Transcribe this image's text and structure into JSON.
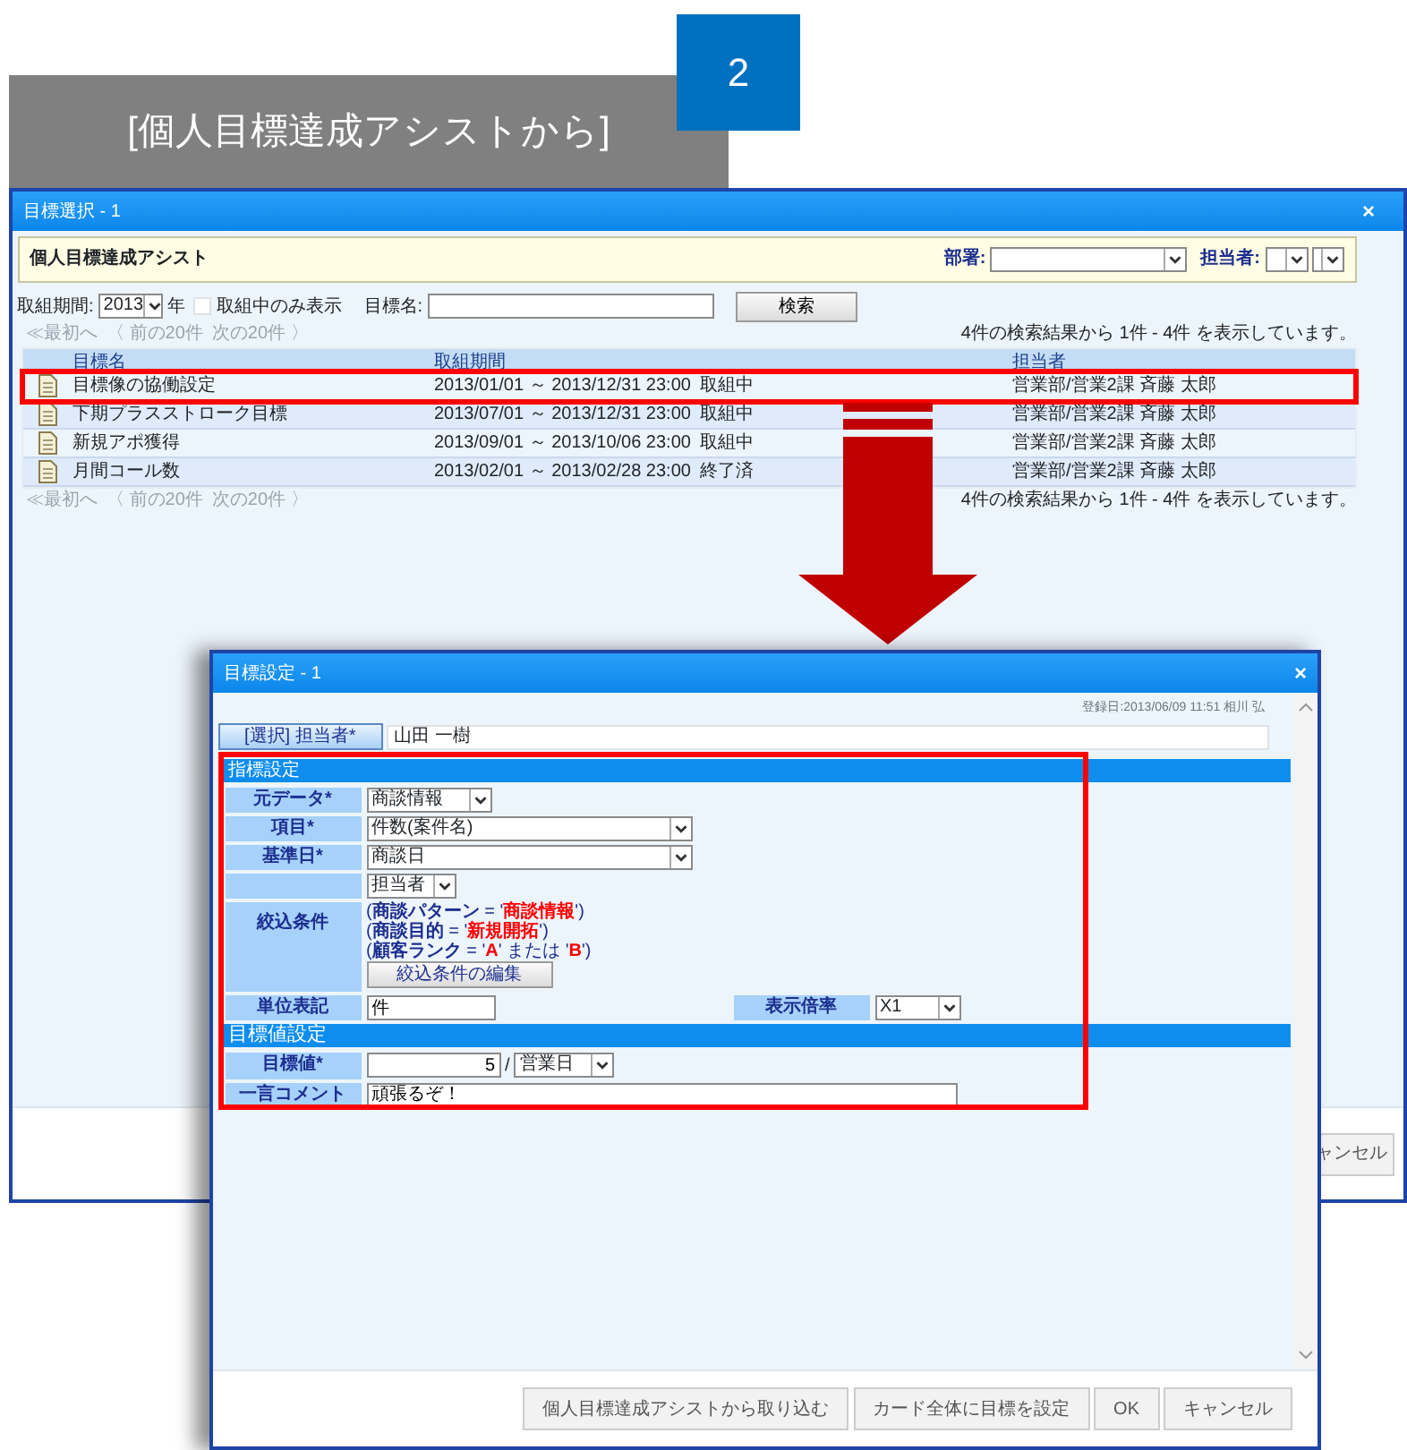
{
  "caption": {
    "text": "[個人目標達成アシストから]",
    "number": "2"
  },
  "window_back": {
    "title": "目標選択 - 1",
    "close": "×",
    "header": {
      "title": "個人目標達成アシスト",
      "dept_label": "部署:",
      "owner_label": "担当者:"
    },
    "filter": {
      "period_label": "取組期間:",
      "year": "2013",
      "year_unit": "年",
      "active_only": {
        "label": "取組中のみ表示",
        "checked": false
      },
      "name_label": "目標名:",
      "search_button": "検索"
    },
    "pager_top": {
      "first": "≪最初へ",
      "prev": "〈 前の20件",
      "next": "次の20件 〉",
      "summary": "4件の検索結果から 1件 - 4件 を表示しています。"
    },
    "columns": [
      "目標名",
      "取組期間",
      "担当者"
    ],
    "rows": [
      {
        "name": "目標像の協働設定",
        "period": "2013/01/01 ～ 2013/12/31 23:00",
        "status": "取組中",
        "owner": "営業部/営業2課 斉藤 太郎",
        "highlighted": true
      },
      {
        "name": "下期プラスストローク目標",
        "period": "2013/07/01 ～ 2013/12/31 23:00",
        "status": "取組中",
        "owner": "営業部/営業2課 斉藤 太郎",
        "highlighted": false
      },
      {
        "name": "新規アポ獲得",
        "period": "2013/09/01 ～ 2013/10/06 23:00",
        "status": "取組中",
        "owner": "営業部/営業2課 斉藤 太郎",
        "highlighted": false
      },
      {
        "name": "月間コール数",
        "period": "2013/02/01 ～ 2013/02/28 23:00",
        "status": "終了済",
        "owner": "営業部/営業2課 斉藤 太郎",
        "highlighted": false
      }
    ],
    "pager_bottom": {
      "first": "≪最初へ",
      "prev": "〈 前の20件",
      "next": "次の20件 〉",
      "summary": "4件の検索結果から 1件 - 4件 を表示しています。"
    },
    "footer_button": "ャンセル"
  },
  "window_front": {
    "title": "目標設定 - 1",
    "close": "×",
    "registered": "登録日:2013/06/09 11:51 相川 弘",
    "assignee_button": "[選択] 担当者*",
    "assignee": "山田 一樹",
    "highlighted": true,
    "section_indicator": "指標設定",
    "source_label": "元データ*",
    "source": "商談情報",
    "item_label": "項目*",
    "item": "件数(案件名)",
    "base_date_label": "基準日*",
    "base_date": "商談日",
    "owner_select": "担当者",
    "filter_label": "絞込条件",
    "conditions": [
      [
        {
          "kind": "plain",
          "text": "("
        },
        {
          "kind": "field",
          "text": "商談パターン"
        },
        {
          "kind": "plain",
          "text": " = '"
        },
        {
          "kind": "value",
          "text": "商談情報"
        },
        {
          "kind": "plain",
          "text": "')"
        }
      ],
      [
        {
          "kind": "plain",
          "text": "("
        },
        {
          "kind": "field",
          "text": "商談目的"
        },
        {
          "kind": "plain",
          "text": " = '"
        },
        {
          "kind": "value",
          "text": "新規開拓"
        },
        {
          "kind": "plain",
          "text": "')"
        }
      ],
      [
        {
          "kind": "plain",
          "text": "("
        },
        {
          "kind": "field",
          "text": "顧客ランク"
        },
        {
          "kind": "plain",
          "text": " = '"
        },
        {
          "kind": "value",
          "text": "A"
        },
        {
          "kind": "plain",
          "text": "' または '"
        },
        {
          "kind": "value",
          "text": "B"
        },
        {
          "kind": "plain",
          "text": "')"
        }
      ]
    ],
    "edit_filter_button": "絞込条件の編集",
    "unit_label": "単位表記",
    "unit": "件",
    "scale_label": "表示倍率",
    "scale": "X1",
    "section_target": "目標値設定",
    "target_label": "目標値*",
    "target": "5",
    "target_sep": "/",
    "target_period": "営業日",
    "comment_label": "一言コメント",
    "comment": "頑張るぞ！",
    "buttons": [
      "個人目標達成アシストから取り込む",
      "カード全体に目標を設定",
      "OK",
      "キャンセル"
    ]
  }
}
